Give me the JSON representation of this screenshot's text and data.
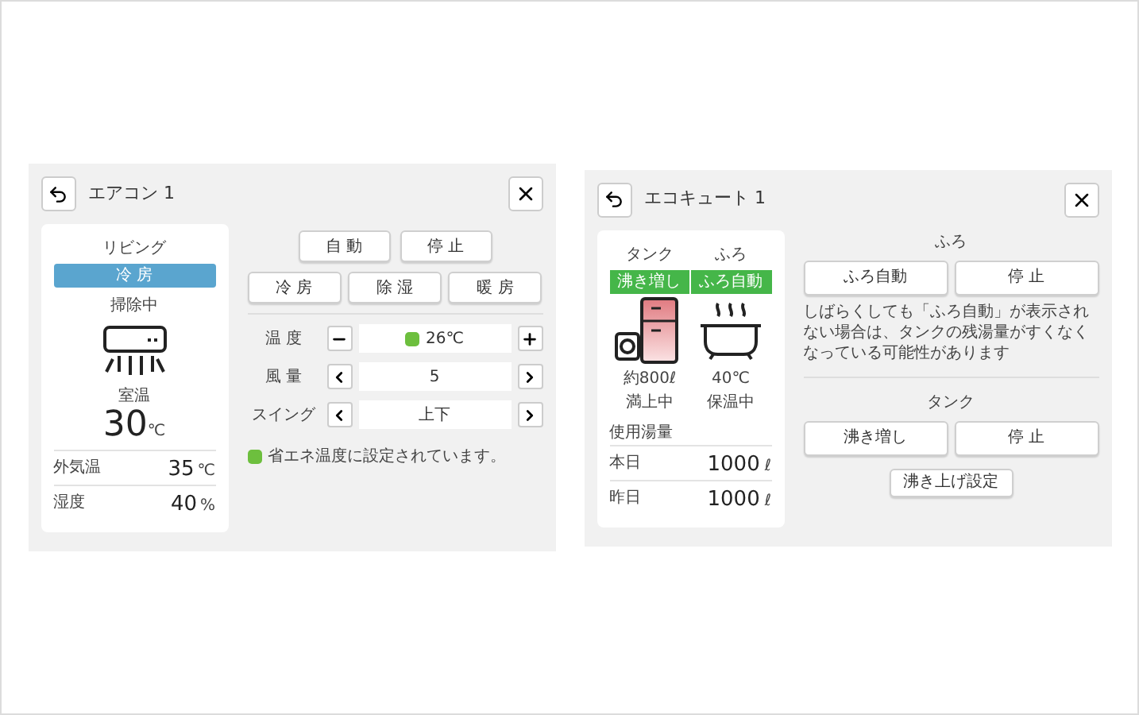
{
  "aircon": {
    "title": "エアコン 1",
    "room": "リビング",
    "mode": "冷 房",
    "status": "掃除中",
    "room_temp_label": "室温",
    "room_temp": "30",
    "room_temp_unit": "℃",
    "readings": [
      {
        "label": "外気温",
        "value": "35",
        "unit": "℃"
      },
      {
        "label": "湿度",
        "value": "40",
        "unit": "%"
      }
    ],
    "top_buttons": [
      "自 動",
      "停 止"
    ],
    "mode_buttons": [
      "冷 房",
      "除 湿",
      "暖 房"
    ],
    "controls": [
      {
        "label": "温 度",
        "value": "26℃",
        "kind": "plusminus",
        "eco": true
      },
      {
        "label": "風 量",
        "value": "5",
        "kind": "arrows",
        "eco": false
      },
      {
        "label": "スイング",
        "value": "上下",
        "kind": "arrows",
        "eco": false
      }
    ],
    "note": "省エネ温度に設定されています。"
  },
  "ecocute": {
    "title": "エコキュート 1",
    "columns": [
      {
        "label": "タンク",
        "status": "沸き増し",
        "kind": "tank",
        "line1": "約800ℓ",
        "line2": "満上中"
      },
      {
        "label": "ふろ",
        "status": "ふろ自動",
        "kind": "bath",
        "line1": "40℃",
        "line2": "保温中"
      }
    ],
    "usage_label": "使用湯量",
    "usage": [
      {
        "label": "本日",
        "value": "1000",
        "unit": "ℓ"
      },
      {
        "label": "昨日",
        "value": "1000",
        "unit": "ℓ"
      }
    ],
    "bath_heading": "ふろ",
    "bath_buttons": [
      "ふろ自動",
      "停 止"
    ],
    "bath_note": "しばらくしても「ふろ自動」が表示されない場合は、タンクの残湯量がすくなくなっている可能性があります",
    "tank_heading": "タンク",
    "tank_buttons": [
      "沸き増し",
      "停 止"
    ],
    "setting_button": "沸き上げ設定"
  }
}
